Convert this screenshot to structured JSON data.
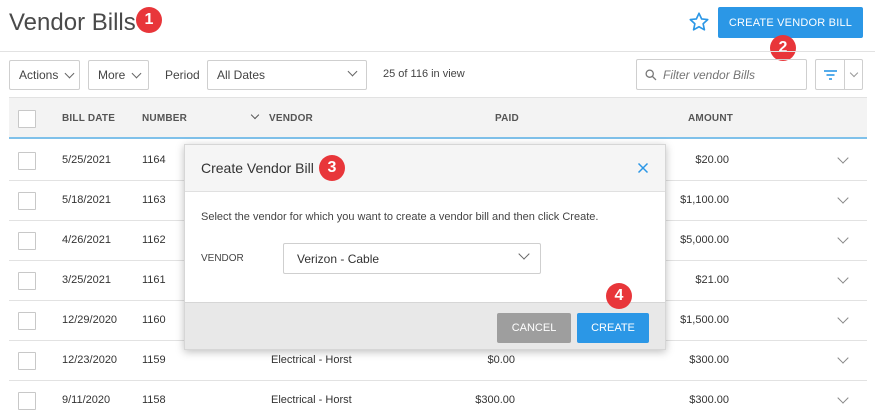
{
  "header": {
    "title": "Vendor Bills",
    "create_button": "CREATE VENDOR BILL",
    "favorite_icon": "star-outline-icon"
  },
  "callouts": [
    "1",
    "2",
    "3",
    "4"
  ],
  "toolbar": {
    "actions_label": "Actions",
    "more_label": "More",
    "period_label": "Period",
    "period_value": "All Dates",
    "view_count": "25 of 116 in view",
    "filter_placeholder": "Filter vendor Bills",
    "filter_icon": "filter-icon"
  },
  "table": {
    "columns": [
      "BILL DATE",
      "NUMBER",
      "VENDOR",
      "PAID",
      "AMOUNT"
    ],
    "rows": [
      {
        "date": "5/25/2021",
        "number": "1164",
        "vendor": "",
        "paid": "",
        "amount": "$20.00"
      },
      {
        "date": "5/18/2021",
        "number": "1163",
        "vendor": "",
        "paid": "",
        "amount": "$1,100.00"
      },
      {
        "date": "4/26/2021",
        "number": "1162",
        "vendor": "",
        "paid": "",
        "amount": "$5,000.00"
      },
      {
        "date": "3/25/2021",
        "number": "1161",
        "vendor": "",
        "paid": "",
        "amount": "$21.00"
      },
      {
        "date": "12/29/2020",
        "number": "1160",
        "vendor": "",
        "paid": "",
        "amount": "$1,500.00"
      },
      {
        "date": "12/23/2020",
        "number": "1159",
        "vendor": "Electrical - Horst",
        "paid": "$0.00",
        "amount": "$300.00"
      },
      {
        "date": "9/11/2020",
        "number": "1158",
        "vendor": "Electrical - Horst",
        "paid": "$300.00",
        "amount": "$300.00"
      }
    ]
  },
  "modal": {
    "title": "Create Vendor Bill",
    "description": "Select the vendor for which you want to create a vendor bill and then click Create.",
    "vendor_label": "VENDOR",
    "vendor_value": "Verizon - Cable",
    "cancel_label": "CANCEL",
    "create_label": "CREATE"
  },
  "colors": {
    "primary": "#2b97e6",
    "callout": "#e8363a",
    "cancel": "#9e9e9e"
  }
}
